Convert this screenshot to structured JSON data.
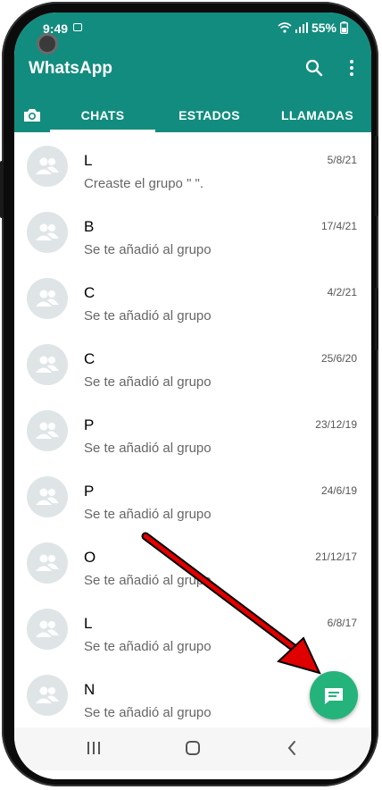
{
  "status_bar": {
    "time": "9:49",
    "battery": "55%"
  },
  "header": {
    "title": "WhatsApp"
  },
  "tabs": [
    {
      "label": "CHATS",
      "active": true
    },
    {
      "label": "ESTADOS",
      "active": false
    },
    {
      "label": "LLAMADAS",
      "active": false
    }
  ],
  "chats": [
    {
      "name": "L",
      "message": "Creaste el grupo \"                 \".",
      "date": "5/8/21"
    },
    {
      "name": "B",
      "message": "Se te añadió al grupo",
      "date": "17/4/21"
    },
    {
      "name": "C",
      "message": "Se te añadió al grupo",
      "date": "4/2/21"
    },
    {
      "name": "C",
      "message": "Se te añadió al grupo",
      "date": "25/6/20"
    },
    {
      "name": "P",
      "message": "Se te añadió al grupo",
      "date": "23/12/19"
    },
    {
      "name": "P",
      "message": "Se te añadió al grupo",
      "date": "24/6/19"
    },
    {
      "name": "O",
      "message": "Se te añadió al grupo",
      "date": "21/12/17"
    },
    {
      "name": "L",
      "message": "Se te añadió al grupo",
      "date": "6/8/17"
    },
    {
      "name": "N",
      "message": "Se te añadió al grupo",
      "date": ""
    }
  ],
  "colors": {
    "header": "#128c7e",
    "fab": "#25b37c",
    "annotation_arrow": "#e00000"
  },
  "icons": {
    "header": [
      "search-icon",
      "more-vert-icon",
      "camera-icon"
    ],
    "fab": "new-chat-icon",
    "nav": [
      "recents-icon",
      "home-icon",
      "back-icon"
    ]
  }
}
